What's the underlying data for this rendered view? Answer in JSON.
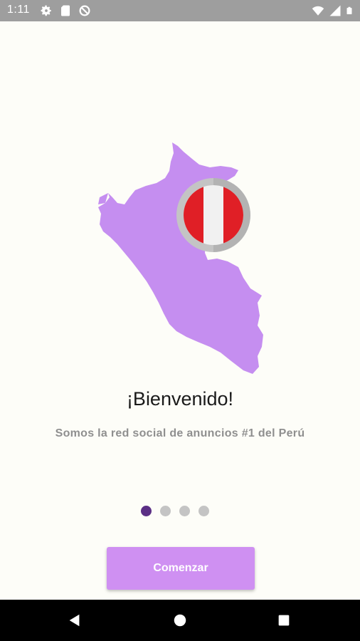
{
  "status_bar": {
    "time": "1:11",
    "left_icons": [
      "gear-icon",
      "sd-card-icon",
      "data-saver-icon"
    ],
    "right_icons": [
      "wifi-icon",
      "cell-signal-icon",
      "battery-icon"
    ]
  },
  "onboarding": {
    "illustration": "peru-map-with-flag",
    "title": "¡Bienvenido!",
    "subtitle": "Somos la red social de anuncios #1 del Perú",
    "page_indicator": {
      "total": 4,
      "current": 1
    },
    "start_button_label": "Comenzar"
  },
  "colors": {
    "map_fill": "#c58ef0",
    "flag_red": "#e01f26",
    "button_bg": "#cf90f2",
    "dot_active": "#5b2f85",
    "dot_inactive": "#c4c4c4"
  },
  "nav_bar": {
    "buttons": [
      "back-icon",
      "home-icon",
      "recents-icon"
    ]
  }
}
